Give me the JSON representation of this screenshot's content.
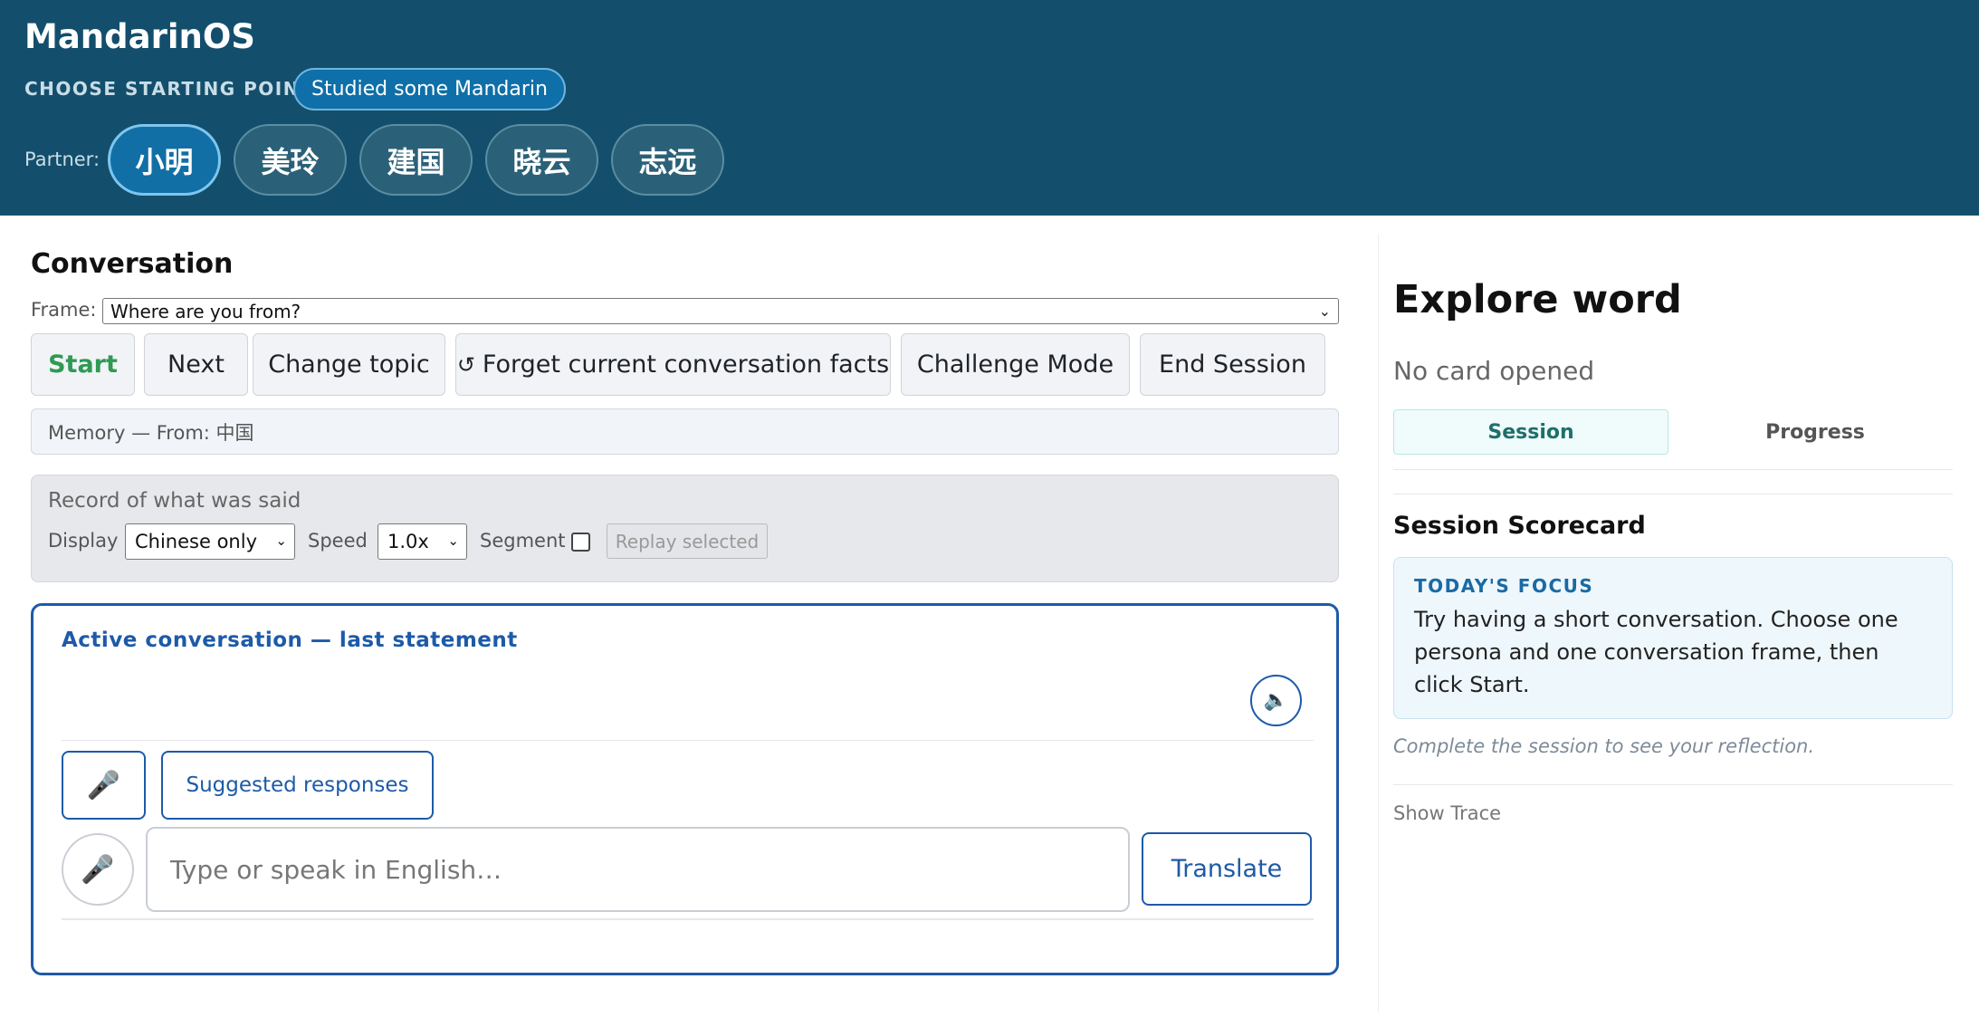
{
  "header": {
    "app_title": "MandarinOS",
    "starting_point_label": "CHOOSE STARTING POINT",
    "starting_point_value": "Studied some Mandarin",
    "partner_label": "Partner:",
    "partners": [
      "小明",
      "美玲",
      "建国",
      "晓云",
      "志远"
    ],
    "active_partner": "小明"
  },
  "conversation": {
    "title": "Conversation",
    "frame_label": "Frame:",
    "frame_value": "Where are you from?",
    "buttons": {
      "start": "Start",
      "next": "Next",
      "change_topic": "Change topic",
      "forget_icon": "↺",
      "forget": "Forget current conversation facts",
      "challenge": "Challenge Mode",
      "end": "End Session"
    },
    "memory": "Memory — From: 中国",
    "record": {
      "title": "Record of what was said",
      "display_label": "Display",
      "display_value": "Chinese only",
      "speed_label": "Speed",
      "speed_value": "1.0x",
      "segment_label": "Segment",
      "segment_checked": false,
      "replay_label": "Replay selected"
    },
    "active": {
      "title": "Active conversation — last statement",
      "suggested_label": "Suggested responses",
      "input_placeholder": "Type or speak in English…",
      "translate_label": "Translate"
    }
  },
  "explore": {
    "title": "Explore word",
    "no_card": "No card opened",
    "tabs": [
      "Session",
      "Progress"
    ],
    "active_tab": "Session",
    "scorecard_title": "Session Scorecard",
    "focus_label": "TODAY'S FOCUS",
    "focus_text": "Try having a short conversation. Choose one persona and one conversation frame, then click Start.",
    "reflection_note": "Complete the session to see your reflection.",
    "show_trace": "Show Trace"
  },
  "icons": {
    "speaker": "speaker-icon",
    "mic": "microphone-icon",
    "chevron": "chevron-down-icon",
    "refresh": "refresh-icon"
  },
  "colors": {
    "header_bg": "#134f6c",
    "accent_blue": "#1d5aa8",
    "start_green": "#2f9a53",
    "session_tab_bg": "#effcfb"
  }
}
